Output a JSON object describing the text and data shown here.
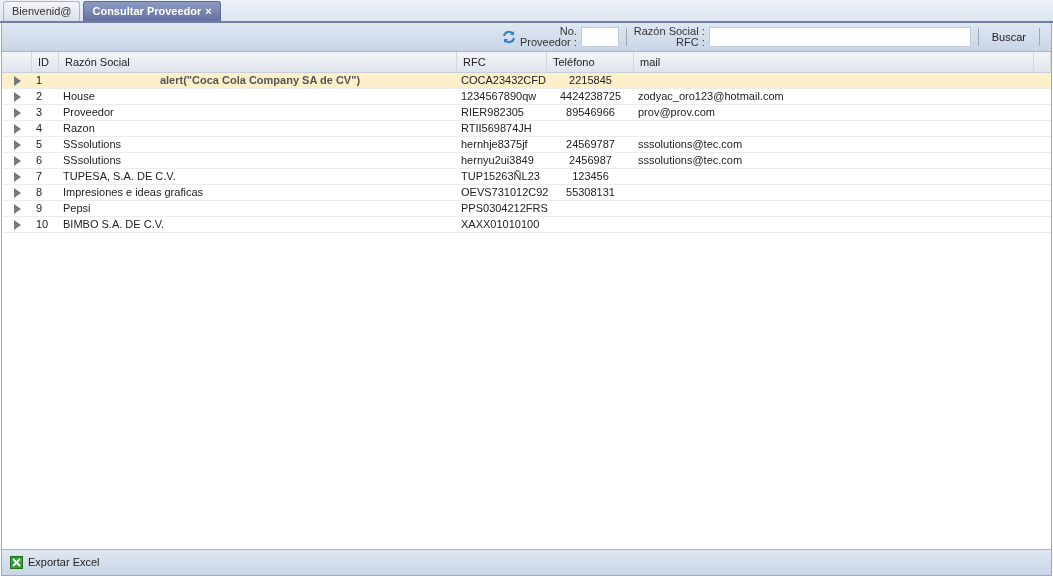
{
  "tabs": [
    {
      "label": "Bienvenid@",
      "selected": false
    },
    {
      "label": "Consultar Proveedor",
      "selected": true,
      "close_glyph": "×"
    }
  ],
  "toolbar": {
    "no_label_1": "No.",
    "no_label_2": "Proveedor :",
    "razon_label_1": "Razón Social :",
    "razon_label_2": "RFC :",
    "search_button": "Buscar"
  },
  "table": {
    "columns": [
      "ID",
      "Razón Social",
      "RFC",
      "Teléfono",
      "mail"
    ],
    "rows": [
      {
        "id": "1",
        "razon": "alert(\"Coca Cola Company SA de CV\")",
        "kind": "emphasized",
        "rfc": "COCA23432CFD",
        "telefono": "2215845",
        "selected": true
      },
      {
        "id": "2",
        "razon": "House",
        "kind": "plain",
        "rfc": "1234567890qw",
        "telefono": "4424238725",
        "mail": "zodyac_oro123@hotmail.com",
        "selected": false
      },
      {
        "id": "3",
        "razon": "Proveedor",
        "kind": "plain",
        "rfc": "RIER982305",
        "telefono": "89546966",
        "mail": "prov@prov.com",
        "selected": false
      },
      {
        "id": "4",
        "razon": "Razon",
        "kind": "plain",
        "rfc": "RTII569874JH",
        "selected": false
      },
      {
        "id": "5",
        "razon": "SSsolutions",
        "kind": "plain",
        "rfc": "hernhje8375jf",
        "telefono": "24569787",
        "mail": "sssolutions@tec.com",
        "selected": false
      },
      {
        "id": "6",
        "razon": "SSsolutions",
        "kind": "plain",
        "rfc": "hernyu2ui3849",
        "telefono": "2456987",
        "mail": "sssolutions@tec.com",
        "selected": false
      },
      {
        "id": "7",
        "razon": "TUPESA, S.A. DE C.V.",
        "kind": "plain",
        "rfc": "TUP15263ÑL23",
        "telefono": "123456",
        "selected": false
      },
      {
        "id": "8",
        "razon": "Impresiones e ideas graficas",
        "kind": "plain",
        "rfc": "OEVS731012C92",
        "telefono": "55308131",
        "selected": false
      },
      {
        "id": "9",
        "razon": "Pepsi",
        "kind": "plain",
        "rfc": "PPS0304212FRS",
        "selected": false
      },
      {
        "id": "10",
        "razon": "BIMBO S.A. DE C.V.",
        "kind": "plain",
        "rfc": "XAXX01010100",
        "selected": false
      }
    ]
  },
  "footer": {
    "export_button": "Exportar Excel"
  }
}
